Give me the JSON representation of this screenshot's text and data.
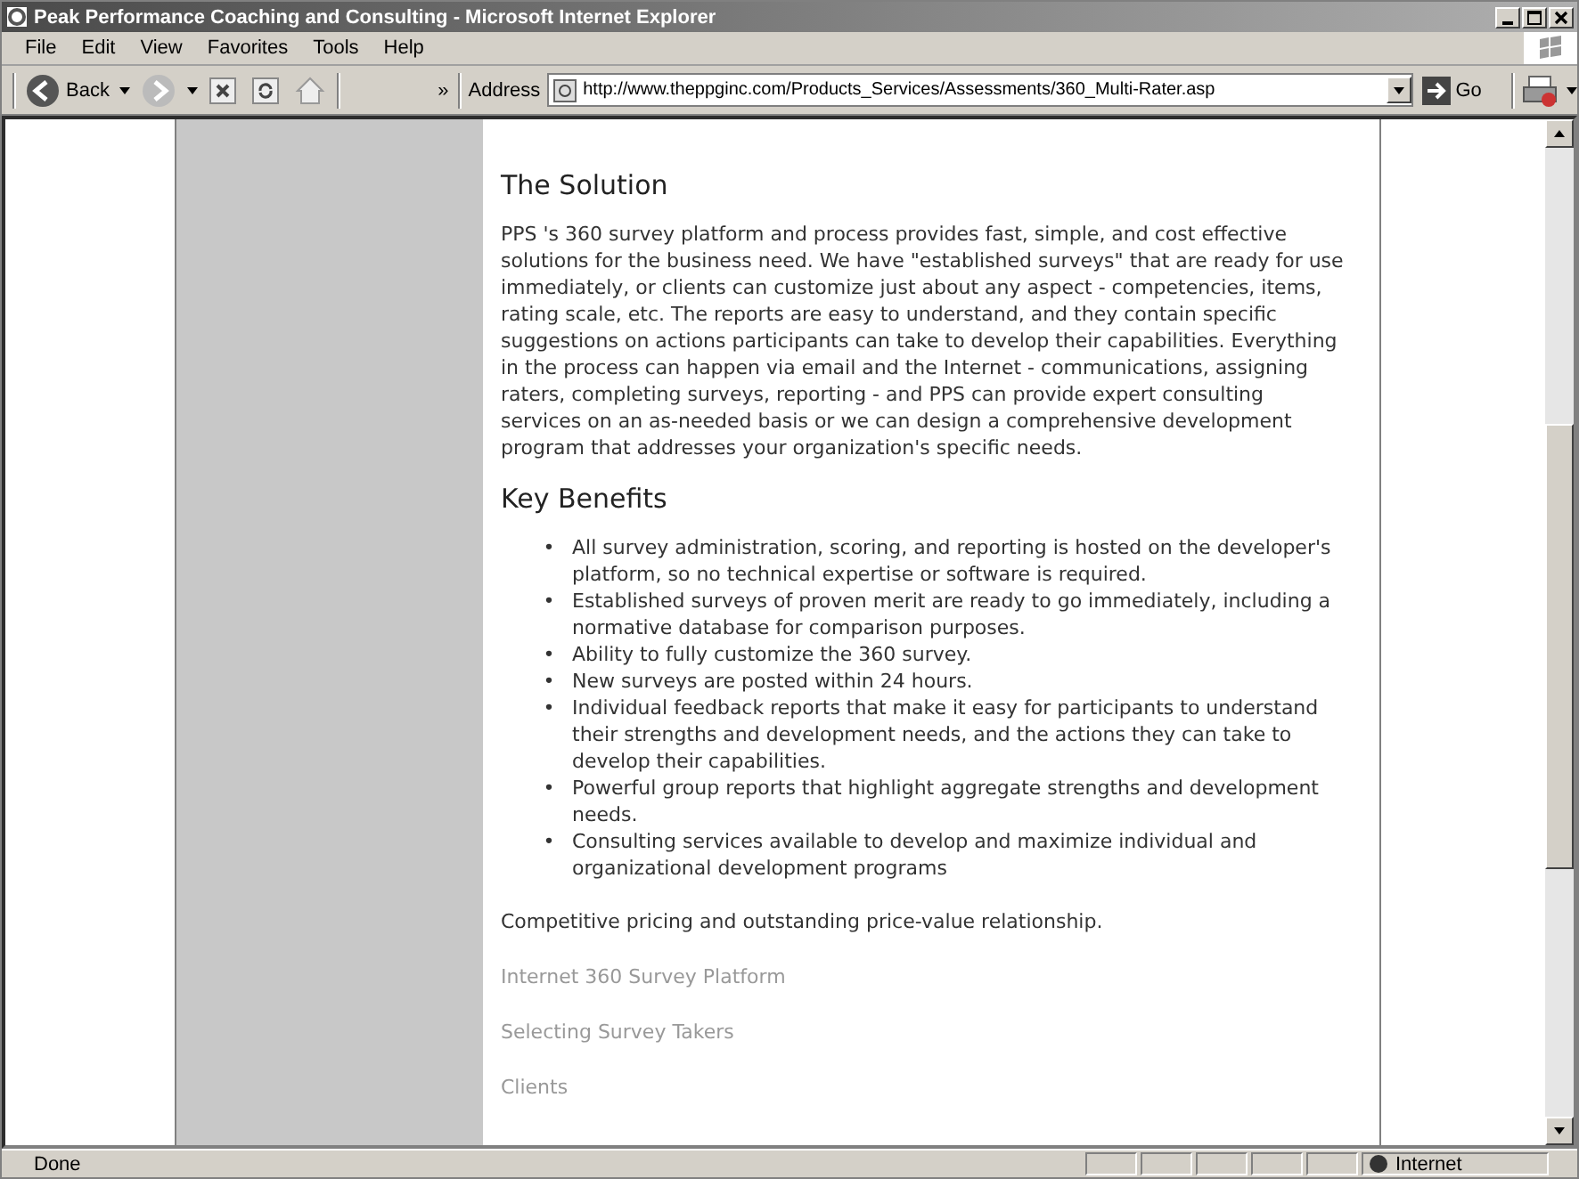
{
  "window": {
    "title": "Peak Performance Coaching and Consulting - Microsoft Internet Explorer"
  },
  "menu": [
    "File",
    "Edit",
    "View",
    "Favorites",
    "Tools",
    "Help"
  ],
  "toolbar": {
    "back_label": "Back",
    "chevron": "»",
    "address_label": "Address",
    "address": "http://www.theppginc.com/Products_Services/Assessments/360_Multi-Rater.asp",
    "go_label": "Go"
  },
  "content": {
    "solution_heading": "The Solution",
    "solution_text": "PPS 's 360 survey platform and process provides fast, simple, and cost effective solutions for the business need. We have \"established surveys\" that are ready for use immediately, or clients can customize just about any aspect - competencies, items, rating scale, etc. The reports are easy to understand, and they contain specific suggestions on actions participants can take to develop their capabilities. Everything in the process can happen via email and the Internet - communications, assigning raters, completing surveys, reporting - and PPS can provide expert consulting services on an as-needed basis or we can design a comprehensive development program that addresses your organization's specific needs.",
    "benefits_heading": "Key Benefits",
    "bullet": "•",
    "benefits": [
      "All survey administration, scoring, and reporting is hosted on the developer's platform, so no technical expertise or software is required.",
      "Established surveys of proven merit are ready to go immediately, including a normative database for comparison purposes.",
      "Ability to fully customize the 360 survey.",
      "New surveys are posted within 24 hours.",
      "Individual feedback reports that make it easy for participants to understand their strengths and development needs, and the actions they can take to develop their capabilities.",
      "Powerful group reports that highlight aggregate strengths and development needs.",
      "Consulting services available to develop and maximize individual and organizational development programs"
    ],
    "pricing": "Competitive pricing and outstanding price-value relationship.",
    "links": [
      "Internet 360 Survey Platform",
      "Selecting Survey Takers",
      "Clients"
    ]
  },
  "status_bar": {
    "text": "Done",
    "zone": "Internet"
  }
}
